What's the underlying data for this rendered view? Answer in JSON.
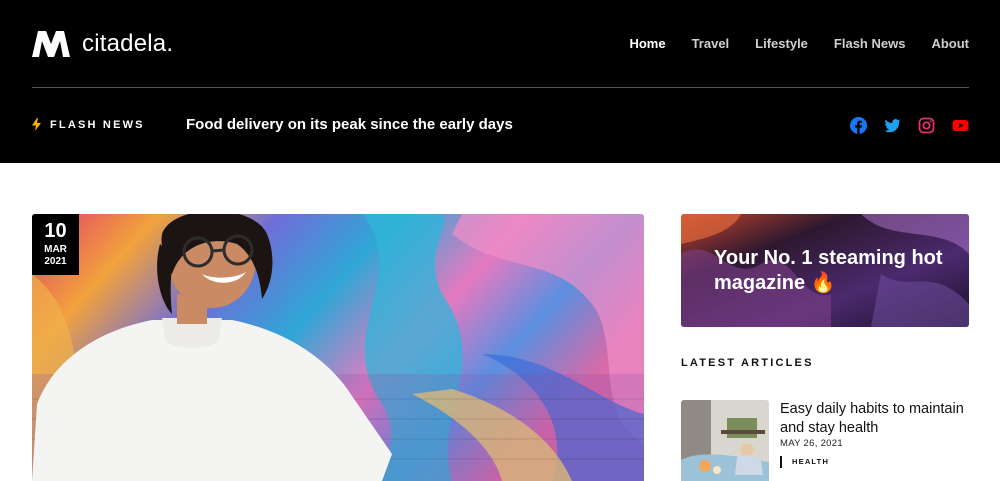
{
  "brand": {
    "name": "citadela."
  },
  "nav": {
    "items": [
      {
        "label": "Home",
        "active": true
      },
      {
        "label": "Travel"
      },
      {
        "label": "Lifestyle"
      },
      {
        "label": "Flash News"
      },
      {
        "label": "About"
      }
    ]
  },
  "flash": {
    "label": "FLASH NEWS",
    "headline": "Food delivery on its peak since the early days",
    "icon": "lightning-icon",
    "icon_color": "#f5b400"
  },
  "socials": [
    {
      "icon": "facebook-icon",
      "color": "#1877f2"
    },
    {
      "icon": "twitter-icon",
      "color": "#1da1f2"
    },
    {
      "icon": "instagram-icon",
      "color": "#e1306c"
    },
    {
      "icon": "youtube-icon",
      "color": "#ff0000"
    }
  ],
  "featured": {
    "date": {
      "day": "10",
      "month": "MAR",
      "year": "2021"
    }
  },
  "promo": {
    "text": "Your No. 1 steaming hot magazine 🔥"
  },
  "latest": {
    "label": "LATEST ARTICLES",
    "items": [
      {
        "title": "Easy daily habits to maintain and stay health",
        "date": "MAY 26, 2021",
        "category": "HEALTH"
      }
    ]
  }
}
